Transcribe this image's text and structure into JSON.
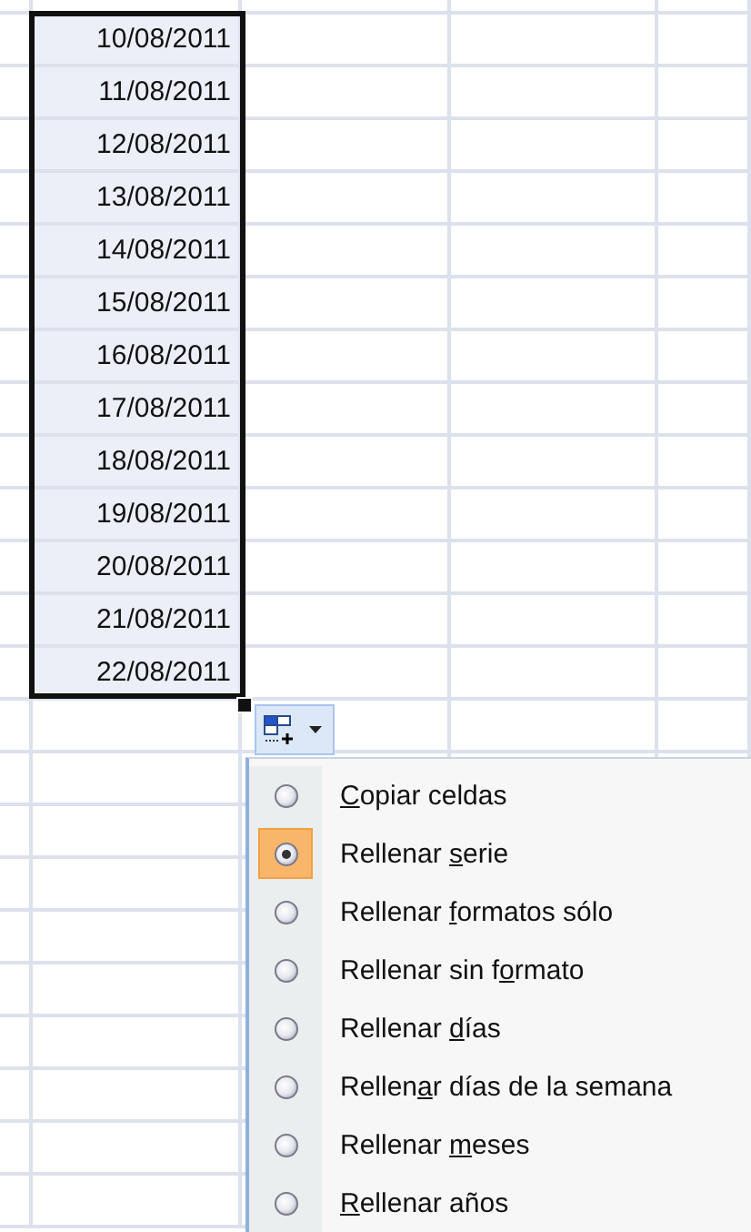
{
  "column_cells": [
    "10/08/2011",
    "11/08/2011",
    "12/08/2011",
    "13/08/2011",
    "14/08/2011",
    "15/08/2011",
    "16/08/2011",
    "17/08/2011",
    "18/08/2011",
    "19/08/2011",
    "20/08/2011",
    "21/08/2011",
    "22/08/2011"
  ],
  "fill_options_menu": {
    "items": [
      {
        "access_key": "C",
        "label_after": "opiar celdas",
        "selected": false
      },
      {
        "label_before": "Rellenar ",
        "access_key": "s",
        "label_after": "erie",
        "selected": true
      },
      {
        "label_before": "Rellenar ",
        "access_key": "f",
        "label_after": "ormatos sólo",
        "selected": false
      },
      {
        "label_before": "Rellenar sin f",
        "access_key": "o",
        "label_after": "rmato",
        "selected": false
      },
      {
        "label_before": "Rellenar ",
        "access_key": "d",
        "label_after": "ías",
        "selected": false
      },
      {
        "label_before": "Rellen",
        "access_key": "a",
        "label_after": "r días de la semana",
        "selected": false
      },
      {
        "label_before": "Rellenar ",
        "access_key": "m",
        "label_after": "eses",
        "selected": false
      },
      {
        "access_key": "R",
        "label_after": "ellenar años",
        "selected": false
      }
    ]
  }
}
